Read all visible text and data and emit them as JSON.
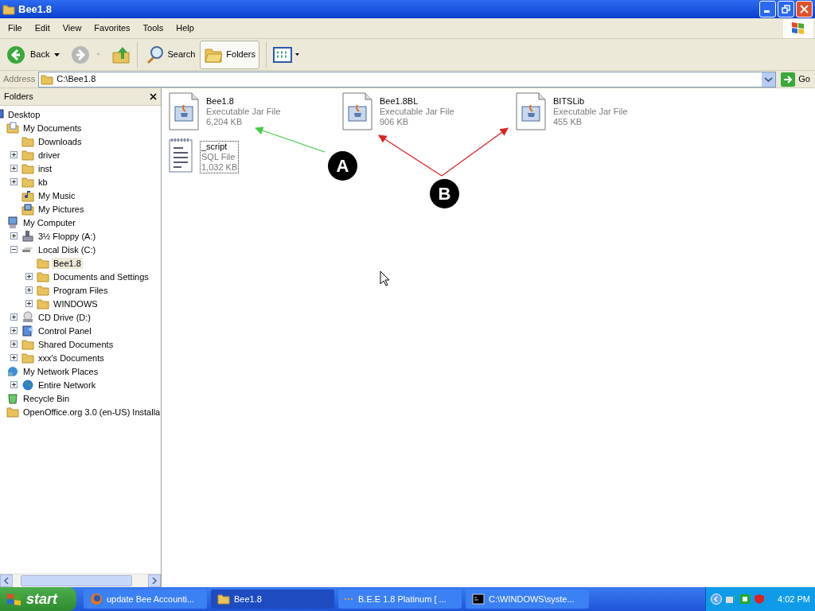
{
  "window": {
    "title": "Bee1.8"
  },
  "menu": [
    "File",
    "Edit",
    "View",
    "Favorites",
    "Tools",
    "Help"
  ],
  "toolbar": {
    "back": "Back",
    "search": "Search",
    "folders": {
      "label": "Folders",
      "pressed": true
    }
  },
  "address": {
    "label": "Address",
    "value": "C:\\Bee1.8",
    "go": "Go"
  },
  "folders_pane": {
    "title": "Folders"
  },
  "tree": [
    {
      "label": "Desktop",
      "kind": "desktop",
      "selected": false,
      "children": [
        {
          "label": "My Documents",
          "kind": "documents",
          "selected": false,
          "children": [
            {
              "label": "Downloads",
              "kind": "folder",
              "selected": false
            },
            {
              "label": "driver",
              "kind": "folder",
              "selected": false,
              "expanded": false
            },
            {
              "label": "inst",
              "kind": "folder",
              "selected": false,
              "expanded": false
            },
            {
              "label": "kb",
              "kind": "folder",
              "selected": false,
              "expanded": false
            },
            {
              "label": "My Music",
              "kind": "music",
              "selected": false
            },
            {
              "label": "My Pictures",
              "kind": "pictures",
              "selected": false
            }
          ]
        },
        {
          "label": "My Computer",
          "kind": "computer",
          "selected": false,
          "children": [
            {
              "label": "3½ Floppy (A:)",
              "kind": "floppy",
              "selected": false,
              "expanded": false
            },
            {
              "label": "Local Disk (C:)",
              "kind": "disk",
              "selected": false,
              "expanded": true,
              "children": [
                {
                  "label": "Bee1.8",
                  "kind": "folder",
                  "selected": true
                },
                {
                  "label": "Documents and Settings",
                  "kind": "folder",
                  "selected": false,
                  "expanded": false
                },
                {
                  "label": "Program Files",
                  "kind": "folder",
                  "selected": false,
                  "expanded": false
                },
                {
                  "label": "WINDOWS",
                  "kind": "folder",
                  "selected": false,
                  "expanded": false
                }
              ]
            },
            {
              "label": "CD Drive (D:)",
              "kind": "cd",
              "selected": false,
              "expanded": false
            },
            {
              "label": "Control Panel",
              "kind": "control",
              "selected": false,
              "expanded": false
            },
            {
              "label": "Shared Documents",
              "kind": "folder",
              "selected": false,
              "expanded": false
            },
            {
              "label": "xxx's Documents",
              "kind": "folder",
              "selected": false,
              "expanded": false
            }
          ]
        },
        {
          "label": "My Network Places",
          "kind": "network",
          "selected": false,
          "children": [
            {
              "label": "Entire Network",
              "kind": "globe",
              "selected": false,
              "expanded": false
            }
          ]
        },
        {
          "label": "Recycle Bin",
          "kind": "recycle",
          "selected": false
        },
        {
          "label": "OpenOffice.org 3.0 (en-US) Installa",
          "kind": "folder",
          "selected": false
        }
      ]
    }
  ],
  "files": [
    {
      "name": "Bee1.8",
      "type": "Executable Jar File",
      "size": "6,204 KB",
      "kind": "jar",
      "focused": false
    },
    {
      "name": "Bee1.8BL",
      "type": "Executable Jar File",
      "size": "906 KB",
      "kind": "jar",
      "focused": false
    },
    {
      "name": "BITSLib",
      "type": "Executable Jar File",
      "size": "455 KB",
      "kind": "jar",
      "focused": false
    },
    {
      "name": "_script",
      "type": "SQL File",
      "size": "1,032 KB",
      "kind": "text",
      "focused": true
    }
  ],
  "annotations": [
    {
      "label": "A",
      "color": "#44cc44"
    },
    {
      "label": "B",
      "color": "#dd2222"
    }
  ],
  "taskbar": {
    "start": "start",
    "tasks": [
      {
        "label": "update Bee Accounti...",
        "kind": "firefox",
        "selected": false
      },
      {
        "label": "Bee1.8",
        "kind": "folder",
        "selected": true
      },
      {
        "label": "B.E.E 1.8 Platinum [ ...",
        "kind": "java",
        "selected": false
      },
      {
        "label": "C:\\WINDOWS\\syste...",
        "kind": "console",
        "selected": false
      }
    ],
    "clock": "4:02 PM"
  }
}
